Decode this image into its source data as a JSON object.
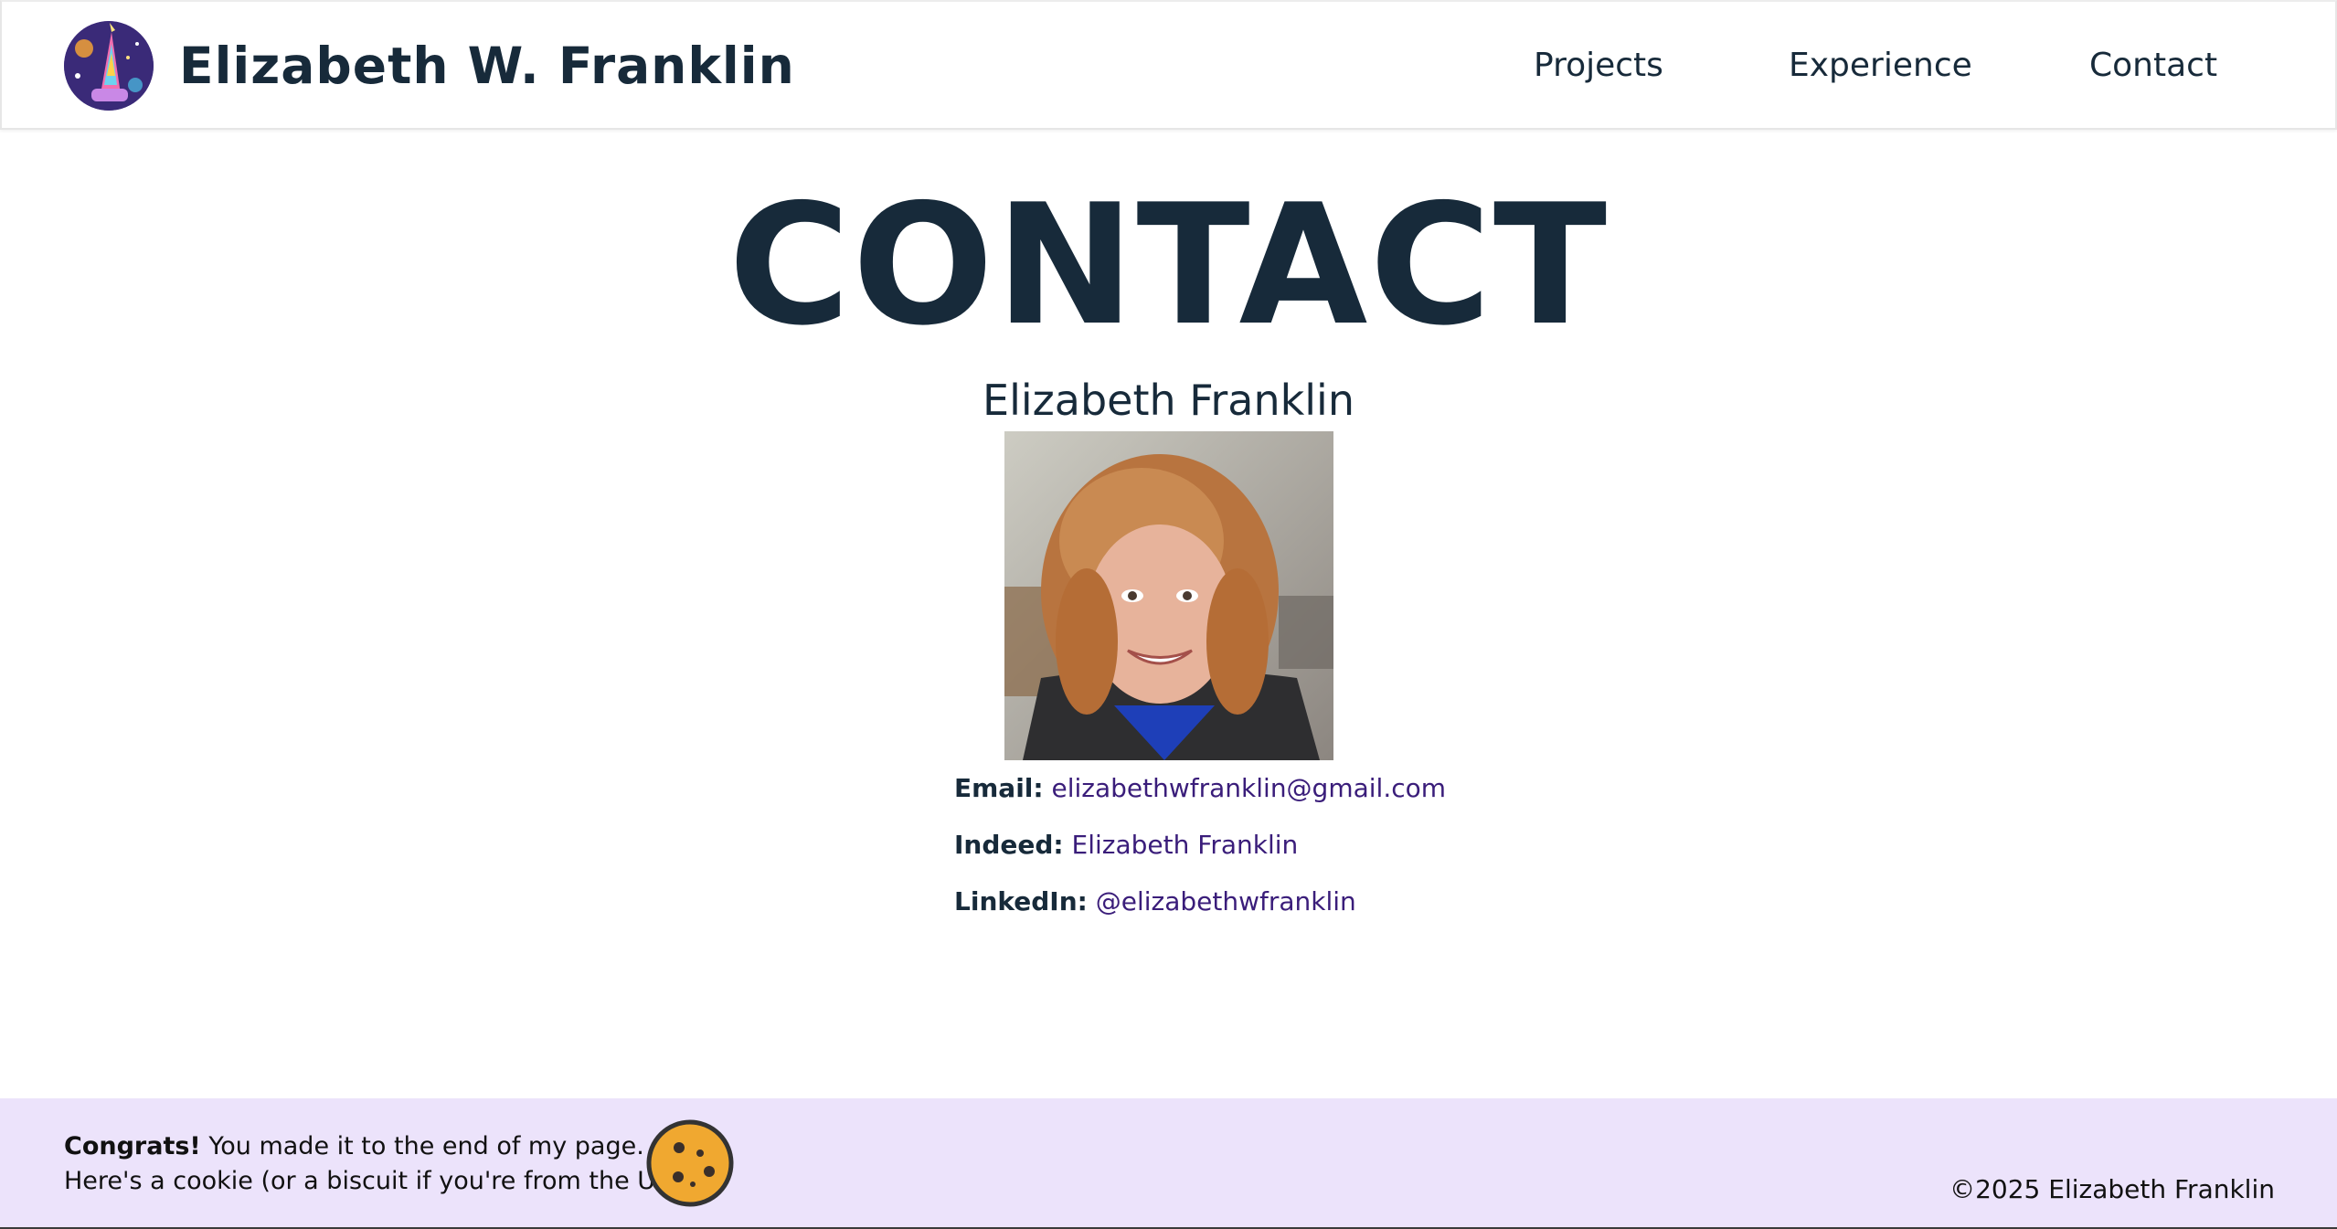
{
  "header": {
    "site_title": "Elizabeth W. Franklin",
    "nav": [
      {
        "label": "Projects"
      },
      {
        "label": "Experience"
      },
      {
        "label": "Contact"
      }
    ]
  },
  "main": {
    "heading": "CONTACT",
    "name": "Elizabeth Franklin",
    "contacts": [
      {
        "label": "Email:",
        "value": "elizabethwfranklin@gmail.com"
      },
      {
        "label": "Indeed:",
        "value": "Elizabeth Franklin"
      },
      {
        "label": "LinkedIn:",
        "value": "@elizabethwfranklin"
      }
    ]
  },
  "footer": {
    "congrats_strong": "Congrats!",
    "congrats_rest": " You made it to the end of my page.",
    "cookie_line": "Here's a cookie (or a biscuit if you're from the UK)!",
    "copyright": "©2025 Elizabeth Franklin"
  },
  "colors": {
    "text_dark": "#172a3a",
    "link_purple": "#3a1d7a",
    "footer_bg": "#ece3fb",
    "cookie_orange": "#f0a830"
  },
  "icons": {
    "logo": "unicorn-logo-icon",
    "cookie": "cookie-icon"
  }
}
